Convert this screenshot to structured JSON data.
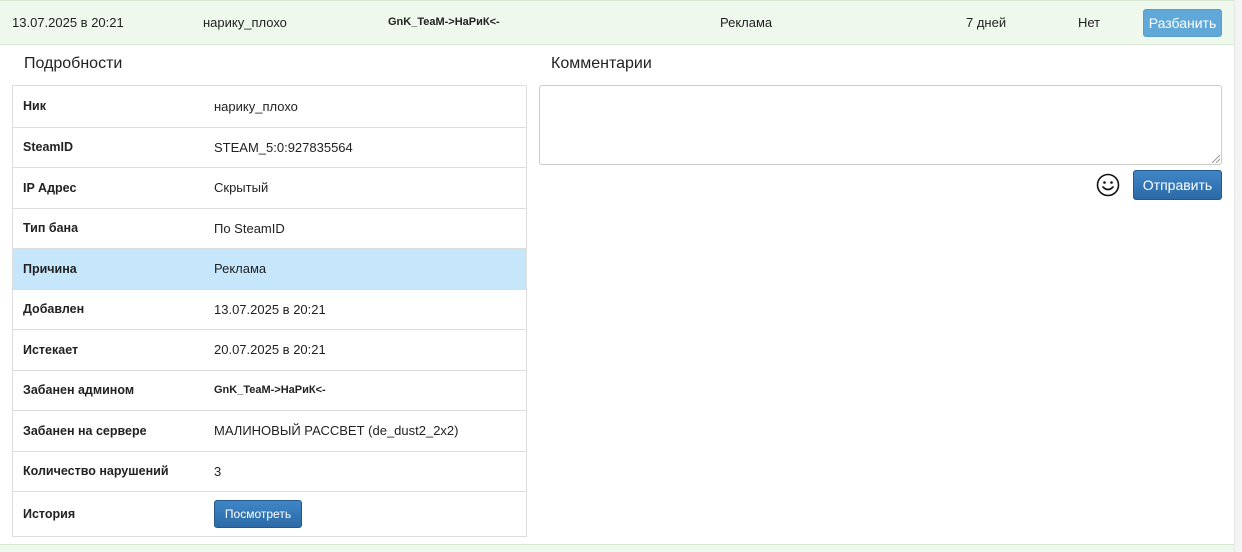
{
  "ban_row": {
    "date": "13.07.2025 в 20:21",
    "nick": "нарику_плохо",
    "admin": "GnK_TeaM->НаРиК<-",
    "reason": "Реклама",
    "length": "7 дней",
    "status": "Нет",
    "unban_label": "Разбанить",
    "unban_color": "#5fa8d8",
    "row_bg": "#eef8ec"
  },
  "details": {
    "title": "Подробности",
    "rows": [
      {
        "label": "Ник",
        "value": "нарику_плохо"
      },
      {
        "label": "SteamID",
        "value": "STEAM_5:0:927835564"
      },
      {
        "label": "IP Адрес",
        "value": "Скрытый"
      },
      {
        "label": "Тип бана",
        "value": "По SteamID"
      },
      {
        "label": "Причина",
        "value": "Реклама"
      },
      {
        "label": "Добавлен",
        "value": "13.07.2025 в 20:21"
      },
      {
        "label": "Истекает",
        "value": "20.07.2025 в 20:21"
      },
      {
        "label": "Забанен админом",
        "value": "GnK_TeaM->НаРиК<-"
      },
      {
        "label": "Забанен на сервере",
        "value": "МАЛИНОВЫЙ РАССВЕТ (de_dust2_2x2)"
      },
      {
        "label": "Количество нарушений",
        "value": "3"
      },
      {
        "label": "История",
        "button_label": "Посмотреть"
      }
    ],
    "highlight_color": "#c6e6fb"
  },
  "comments": {
    "title": "Комментарии",
    "textarea_value": "",
    "smiley_icon": "smiley-icon",
    "send_label": "Отправить",
    "button_color": "#2f74b5"
  }
}
